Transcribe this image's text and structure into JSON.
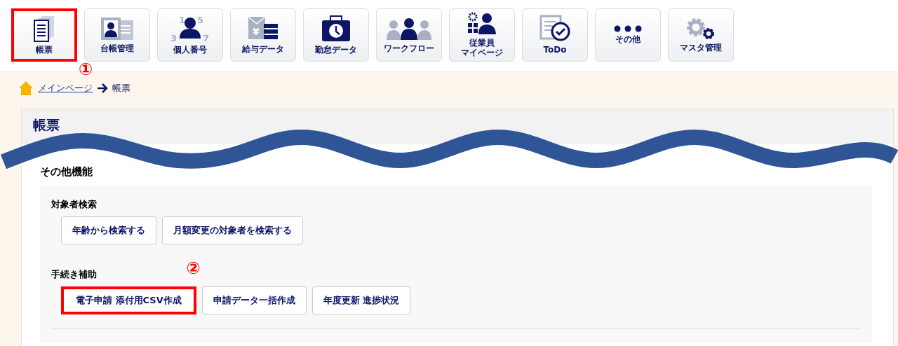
{
  "toolbar": {
    "tiles": [
      {
        "label_lines": [
          "帳票"
        ],
        "kind": "document",
        "highlighted": true,
        "callout": "①"
      },
      {
        "label_lines": [
          "台帳管理"
        ],
        "kind": "card",
        "highlighted": false
      },
      {
        "label_lines": [
          "個人番号"
        ],
        "kind": "numbers",
        "icon_text": [
          "1",
          "5",
          "3",
          "7"
        ],
        "highlighted": false
      },
      {
        "label_lines": [
          "給与データ"
        ],
        "kind": "salary",
        "icon_text": [
          "¥"
        ],
        "highlighted": false
      },
      {
        "label_lines": [
          "勤怠データ"
        ],
        "kind": "clock",
        "highlighted": false
      },
      {
        "label_lines": [
          "ワークフロー"
        ],
        "kind": "people",
        "highlighted": false
      },
      {
        "label_lines": [
          "従業員",
          "マイページ"
        ],
        "kind": "employee",
        "highlighted": false
      },
      {
        "label_lines": [
          "ToDo"
        ],
        "kind": "todo",
        "highlighted": false
      },
      {
        "label_lines": [
          "その他"
        ],
        "kind": "dots",
        "highlighted": false
      },
      {
        "label_lines": [
          "マスタ管理"
        ],
        "kind": "gears",
        "highlighted": false
      }
    ]
  },
  "breadcrumb": {
    "link": "メインページ",
    "current": "帳票"
  },
  "panel": {
    "title": "帳票",
    "section": "その他機能",
    "groups": [
      {
        "title": "対象者検索",
        "buttons": [
          {
            "label": "年齢から検索する",
            "highlighted": false
          },
          {
            "label": "月額変更の対象者を検索する",
            "highlighted": false
          }
        ]
      },
      {
        "title": "手続き補助",
        "buttons": [
          {
            "label": "電子申請 添付用CSV作成",
            "highlighted": true,
            "callout": "②"
          },
          {
            "label": "申請データ一括作成",
            "highlighted": false
          },
          {
            "label": "年度更新 進捗状況",
            "highlighted": false
          }
        ]
      }
    ]
  }
}
